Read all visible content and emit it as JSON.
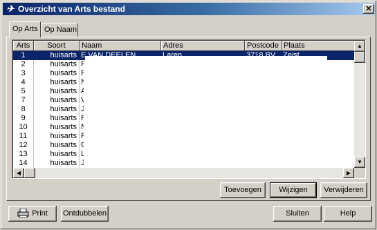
{
  "window": {
    "title": "Overzicht van Arts bestand",
    "title_icon": "app-icon",
    "close_label": "x"
  },
  "tabs": [
    {
      "label": "Op Arts",
      "active": true
    },
    {
      "label": "Op Naam",
      "active": false
    }
  ],
  "grid": {
    "columns": [
      "Arts",
      "Soort",
      "Naam",
      "Adres",
      "Postcode",
      "Plaats"
    ],
    "selected_row": {
      "num": "1",
      "soort": "huisarts",
      "naam": "E.VAN DEELEN",
      "adres": "Laren",
      "postcode": "3718 BV",
      "plaats": "Zeist"
    },
    "rows": [
      {
        "num": "2",
        "soort": "huisarts",
        "naam_initial": "F"
      },
      {
        "num": "3",
        "soort": "huisarts",
        "naam_initial": "F"
      },
      {
        "num": "4",
        "soort": "huisarts",
        "naam_initial": "N"
      },
      {
        "num": "5",
        "soort": "huisarts",
        "naam_initial": "A"
      },
      {
        "num": "7",
        "soort": "huisarts",
        "naam_initial": "V"
      },
      {
        "num": "8",
        "soort": "huisarts",
        "naam_initial": "J"
      },
      {
        "num": "9",
        "soort": "huisarts",
        "naam_initial": "F"
      },
      {
        "num": "10",
        "soort": "huisarts",
        "naam_initial": "N"
      },
      {
        "num": "11",
        "soort": "huisarts",
        "naam_initial": "F"
      },
      {
        "num": "12",
        "soort": "huisarts",
        "naam_initial": "C"
      },
      {
        "num": "13",
        "soort": "huisarts",
        "naam_initial": "L"
      },
      {
        "num": "14",
        "soort": "huisarts",
        "naam_initial": "J"
      }
    ]
  },
  "panel_buttons": {
    "toevoegen": "Toevoegen",
    "wijzigen": "Wijzigen",
    "verwijderen": "Verwijderen"
  },
  "footer_buttons": {
    "print": "Print",
    "ontdubbelen": "Ontdubbelen",
    "sluiten": "Sluiten",
    "help": "Help"
  },
  "colors": {
    "selection": "#0a246a",
    "face": "#d4d0c8"
  }
}
